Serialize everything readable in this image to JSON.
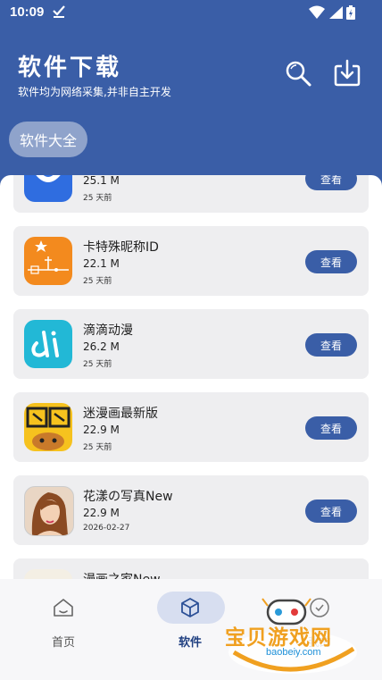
{
  "status_bar": {
    "time": "10:09"
  },
  "header": {
    "title": "软件下载",
    "subtitle": "软件均为网络采集,并非自主开发"
  },
  "category": {
    "label": "软件大全"
  },
  "apps": [
    {
      "name": "",
      "size": "25.1 M",
      "date": "25 天前",
      "button": "查看",
      "icon": "app-icon-blue"
    },
    {
      "name": "卡特殊昵称ID",
      "size": "22.1 M",
      "date": "25 天前",
      "button": "查看",
      "icon": "app-icon-orange"
    },
    {
      "name": "滴滴动漫",
      "size": "26.2 M",
      "date": "25 天前",
      "button": "查看",
      "icon": "app-icon-cyan"
    },
    {
      "name": "迷漫画最新版",
      "size": "22.9 M",
      "date": "25 天前",
      "button": "查看",
      "icon": "app-icon-manhua"
    },
    {
      "name": "花漾の写真New",
      "size": "22.9 M",
      "date": "2026-02-27",
      "button": "查看",
      "icon": "app-icon-portrait"
    },
    {
      "name": "漫画之家New",
      "size": "",
      "date": "",
      "button": "",
      "icon": "app-icon-partial"
    }
  ],
  "nav": {
    "home": "首页",
    "software": "软件",
    "profile": "我的"
  },
  "watermark": {
    "text": "宝贝游戏网",
    "url": "baobeiy.com"
  },
  "colors": {
    "primary": "#3a5ea7",
    "card_bg": "#eeeef0",
    "nav_active_pill": "#d7def0"
  }
}
